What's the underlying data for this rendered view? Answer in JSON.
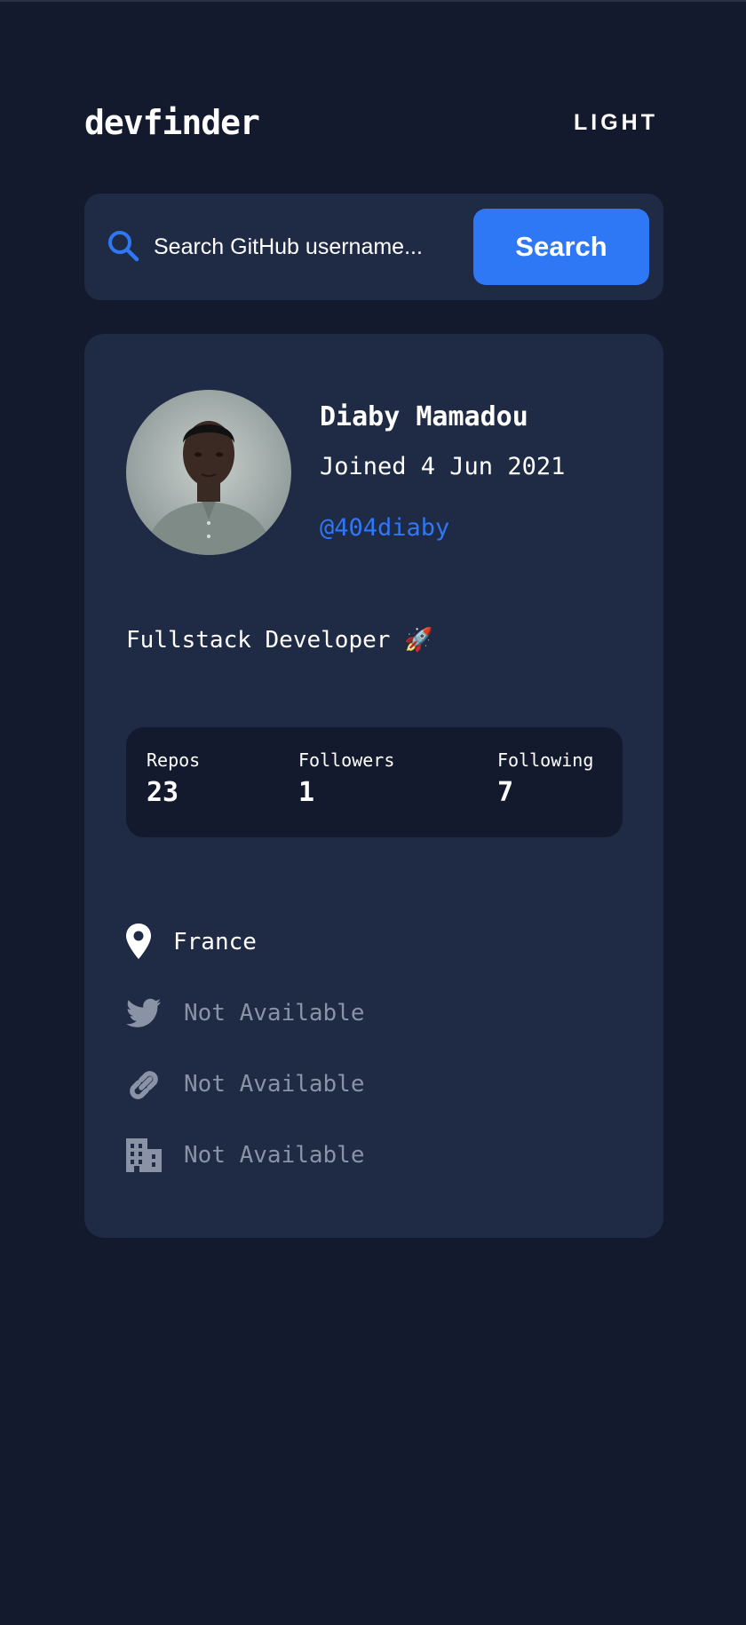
{
  "header": {
    "logo": "devfinder",
    "theme_toggle": "LIGHT"
  },
  "search": {
    "placeholder": "Search GitHub username...",
    "button_label": "Search",
    "icon": "search-icon"
  },
  "profile": {
    "name": "Diaby Mamadou",
    "joined": "Joined 4 Jun 2021",
    "handle": "@404diaby",
    "bio": "Fullstack Developer 🚀",
    "stats": [
      {
        "label": "Repos",
        "value": "23"
      },
      {
        "label": "Followers",
        "value": "1"
      },
      {
        "label": "Following",
        "value": "7"
      }
    ],
    "links": [
      {
        "icon": "location-pin-icon",
        "text": "France",
        "available": true
      },
      {
        "icon": "twitter-icon",
        "text": "Not Available",
        "available": false
      },
      {
        "icon": "link-icon",
        "text": "Not Available",
        "available": false
      },
      {
        "icon": "building-icon",
        "text": "Not Available",
        "available": false
      }
    ]
  },
  "colors": {
    "background": "#141a2d",
    "card": "#1f2a45",
    "accent": "#2f78f5",
    "muted": "#8a93a6"
  }
}
